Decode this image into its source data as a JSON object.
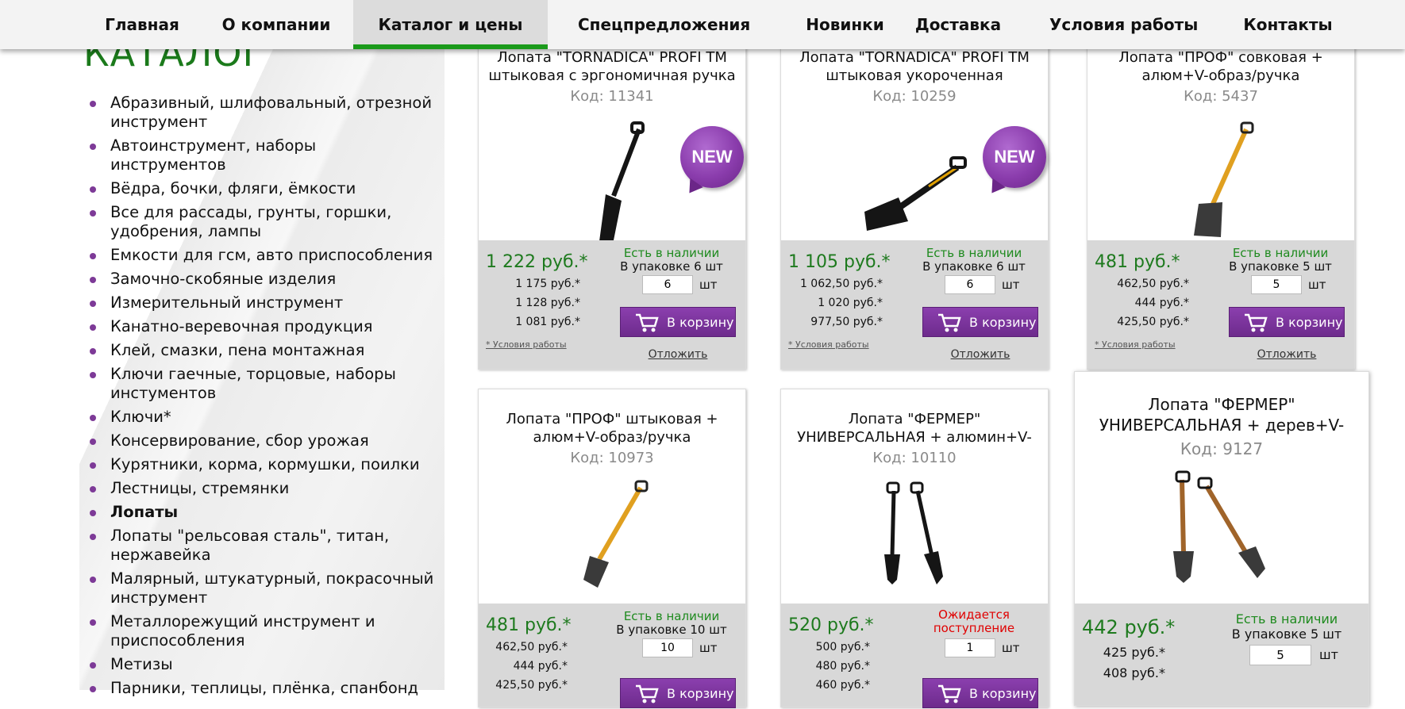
{
  "nav": {
    "items": [
      {
        "label": "Главная"
      },
      {
        "label": "О компании"
      },
      {
        "label": "Каталог и цены",
        "active": true
      },
      {
        "label": "Спецпредложения"
      },
      {
        "label": "Новинки"
      },
      {
        "label": "Доставка"
      },
      {
        "label": "Условия работы"
      },
      {
        "label": "Контакты"
      }
    ]
  },
  "sidebar": {
    "title": "КАТАЛОГ",
    "items": [
      {
        "label": "Абразивный, шлифовальный, отрезной инструмент"
      },
      {
        "label": "Автоинструмент, наборы инструментов"
      },
      {
        "label": "Вёдра, бочки, фляги, ёмкости"
      },
      {
        "label": "Все для рассады, грунты, горшки, удобрения, лампы"
      },
      {
        "label": "Емкости для гсм, авто приспособления"
      },
      {
        "label": "Замочно-скобяные изделия"
      },
      {
        "label": "Измерительный инструмент"
      },
      {
        "label": "Канатно-веревочная продукция"
      },
      {
        "label": "Клей, смазки, пена монтажная"
      },
      {
        "label": "Ключи гаечные, торцовые, наборы инстументов"
      },
      {
        "label": "Ключи*"
      },
      {
        "label": "Консервирование, сбор урожая"
      },
      {
        "label": "Курятники, корма, кормушки, поилки"
      },
      {
        "label": "Лестницы, стремянки"
      },
      {
        "label": "Лопаты",
        "current": true
      },
      {
        "label": "Лопаты \"рельсовая сталь\", титан, нержавейка"
      },
      {
        "label": "Малярный, штукатурный, покрасочный инструмент"
      },
      {
        "label": "Металлорежущий инструмент и приспособления"
      },
      {
        "label": "Метизы"
      },
      {
        "label": "Парники, теплицы, плёнка, спанбонд"
      }
    ]
  },
  "common": {
    "in_stock": "Есть в наличии",
    "cart_label": "В корзину",
    "postpone_label": "Отложить",
    "terms_label": "* Условия работы",
    "unit": "шт",
    "new_badge": "NEW",
    "accent_color": "#7d3a97",
    "price_color": "#1e7a1e"
  },
  "products": [
    {
      "name": "Лопата \"TORNADICA\" PROFI TM штыковая с эргономичная ручка",
      "code": "Код: 11341",
      "is_new": true,
      "image": "black-shovel-icon",
      "price": "1 222 руб.*",
      "sub_prices": [
        "1 175 руб.*",
        "1 128 руб.*",
        "1 081 руб.*"
      ],
      "stock_status": "Есть в наличии",
      "pack": "В упаковке 6 шт",
      "qty": "6"
    },
    {
      "name": "Лопата \"TORNADICA\" PROFI TM штыковая укороченная",
      "code": "Код: 10259",
      "is_new": true,
      "image": "short-shovel-icon",
      "price": "1 105 руб.*",
      "sub_prices": [
        "1 062,50 руб.*",
        "1 020 руб.*",
        "977,50 руб.*"
      ],
      "stock_status": "Есть в наличии",
      "pack": "В упаковке 6 шт",
      "qty": "6"
    },
    {
      "name": "Лопата \"ПРОФ\" совковая + алюм+V-образ/ручка",
      "code": "Код: 5437",
      "is_new": false,
      "image": "scoop-shovel-icon",
      "price": "481 руб.*",
      "sub_prices": [
        "462,50 руб.*",
        "444 руб.*",
        "425,50 руб.*"
      ],
      "stock_status": "Есть в наличии",
      "pack": "В упаковке 5 шт",
      "qty": "5"
    },
    {
      "name": "Лопата \"ПРОФ\" штыковая + алюм+V-образ/ручка",
      "code": "Код: 10973",
      "is_new": false,
      "image": "spade-icon",
      "price": "481 руб.*",
      "sub_prices": [
        "462,50 руб.*",
        "444 руб.*",
        "425,50 руб.*"
      ],
      "stock_status": "Есть в наличии",
      "pack": "В упаковке 10 шт",
      "qty": "10"
    },
    {
      "name": "Лопата \"ФЕРМЕР\" УНИВЕРСАЛЬНАЯ + алюмин+V-",
      "code": "Код: 10110",
      "is_new": false,
      "image": "two-shovels-icon",
      "price": "520 руб.*",
      "sub_prices": [
        "500 руб.*",
        "480 руб.*",
        "460 руб.*"
      ],
      "stock_status": "Ожидается поступление",
      "pack": "",
      "qty": "1"
    },
    {
      "name": "Лопата \"ФЕРМЕР\" УНИВЕРСАЛЬНАЯ + дерев+V-",
      "code": "Код: 9127",
      "is_new": false,
      "image": "wooden-shovels-icon",
      "price": "442 руб.*",
      "sub_prices": [
        "425 руб.*",
        "408 руб.*"
      ],
      "stock_status": "Есть в наличии",
      "pack": "В упаковке 5 шт",
      "qty": "5"
    }
  ]
}
